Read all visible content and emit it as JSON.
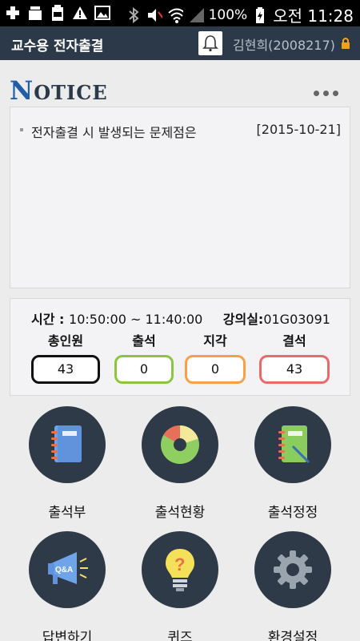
{
  "status_bar": {
    "battery": "100%",
    "time": "오전 11:28",
    "icons": [
      "plus-icon",
      "usb-icon",
      "battery-box-icon",
      "warning-icon",
      "image-icon",
      "bluetooth-icon",
      "mute-icon",
      "wifi-icon",
      "signal-icon",
      "charging-battery-icon"
    ]
  },
  "header": {
    "title": "교수용 전자출결",
    "user": "김현희(2008217)",
    "icons": [
      "bell-icon",
      "lock-icon"
    ]
  },
  "notice": {
    "title_first": "N",
    "title_rest": "OTICE",
    "items": [
      {
        "text": "전자출결 시 발생되는 문제점은",
        "date": "[2015-10-21]"
      }
    ]
  },
  "attendance": {
    "time_label": "시간 : ",
    "time_value": "10:50:00 ~ 11:40:00",
    "room_label": "강의실:",
    "room_value": "01G03091",
    "stats": [
      {
        "label": "총인원",
        "value": "43",
        "color": "#111111"
      },
      {
        "label": "출석",
        "value": "0",
        "color": "#8cc63f"
      },
      {
        "label": "지각",
        "value": "0",
        "color": "#f7a04a"
      },
      {
        "label": "결석",
        "value": "43",
        "color": "#e86a6a"
      }
    ]
  },
  "menu": [
    {
      "label": "출석부",
      "icon": "notebook-icon"
    },
    {
      "label": "출석현황",
      "icon": "donut-chart-icon"
    },
    {
      "label": "출석정정",
      "icon": "notebook-pen-icon"
    },
    {
      "label": "답변하기",
      "icon": "megaphone-qa-icon"
    },
    {
      "label": "퀴즈",
      "icon": "lightbulb-question-icon"
    },
    {
      "label": "환경설정",
      "icon": "gear-icon"
    }
  ],
  "colors": {
    "header_bg": "#2b3949",
    "menu_circle": "#2e3a47",
    "notice_accent": "#1f5fa6"
  }
}
